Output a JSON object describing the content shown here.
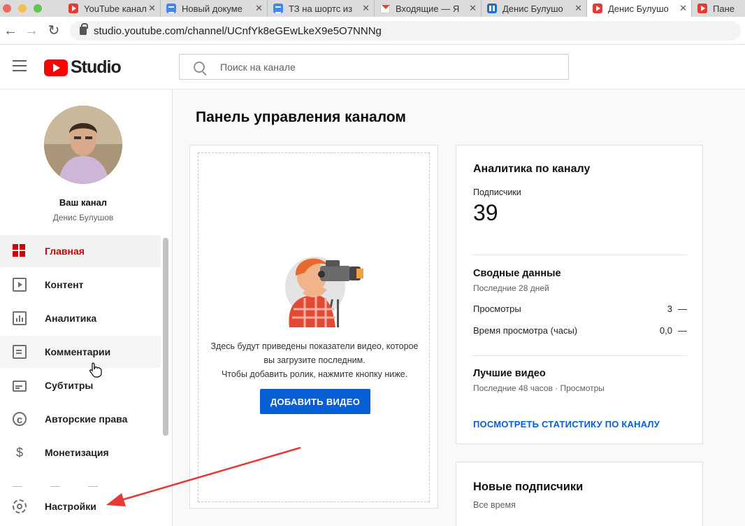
{
  "browser": {
    "tabs": [
      {
        "label": "YouTube канал",
        "fav": "yt"
      },
      {
        "label": "Новый докуме",
        "fav": "doc"
      },
      {
        "label": "ТЗ на шортс из",
        "fav": "doc"
      },
      {
        "label": "Входящие — Я",
        "fav": "mail"
      },
      {
        "label": "Денис Булушо",
        "fav": "trello"
      },
      {
        "label": "Денис Булушо",
        "fav": "yt"
      },
      {
        "label": "Пане",
        "fav": "yt"
      }
    ],
    "url": "studio.youtube.com/channel/UCnfYk8eGEwLkeX9e5O7NNNg",
    "icons": {
      "back": "arrow-left-icon",
      "forward": "arrow-right-icon",
      "reload": "reload-icon",
      "lock": "lock-icon"
    }
  },
  "header": {
    "logo_text": "Studio",
    "search_placeholder": "Поиск на канале"
  },
  "sidebar": {
    "channel_label": "Ваш канал",
    "channel_owner": "Денис Булушов",
    "items": [
      {
        "label": "Главная",
        "icon": "dashboard-icon",
        "active": true
      },
      {
        "label": "Контент",
        "icon": "content-icon"
      },
      {
        "label": "Аналитика",
        "icon": "analytics-icon"
      },
      {
        "label": "Комментарии",
        "icon": "comments-icon"
      },
      {
        "label": "Субтитры",
        "icon": "subtitles-icon"
      },
      {
        "label": "Авторские права",
        "icon": "copyright-icon"
      },
      {
        "label": "Монетизация",
        "icon": "monetization-icon"
      },
      {
        "label": "Настройки",
        "icon": "settings-icon"
      }
    ]
  },
  "main": {
    "title": "Панель управления каналом",
    "upload_card": {
      "line1": "Здесь будут приведены показатели видео, которое",
      "line2": "вы загрузите последним.",
      "line3": "Чтобы добавить ролик, нажмите кнопку ниже.",
      "button": "ДОБАВИТЬ ВИДЕО"
    },
    "analytics": {
      "title": "Аналитика по каналу",
      "subscribers_label": "Подписчики",
      "subscribers_value": "39",
      "summary_title": "Сводные данные",
      "summary_period": "Последние 28 дней",
      "metrics": [
        {
          "label": "Просмотры",
          "value": "3",
          "trend": "—"
        },
        {
          "label": "Время просмотра (часы)",
          "value": "0,0",
          "trend": "—"
        }
      ],
      "top_title": "Лучшие видео",
      "top_period": "Последние 48 часов · Просмотры",
      "link": "ПОСМОТРЕТЬ СТАТИСТИКУ ПО КАНАЛУ"
    },
    "new_subs": {
      "title": "Новые подписчики",
      "period": "Все время"
    }
  },
  "colors": {
    "accent": "#065fd4",
    "brand": "#ff0000",
    "active_nav": "#cc0000",
    "annotation_arrow": "#e53935"
  }
}
